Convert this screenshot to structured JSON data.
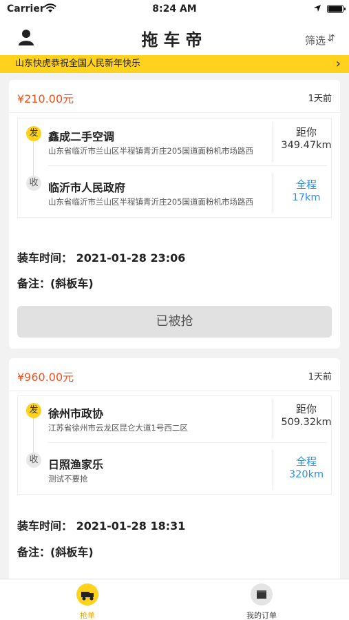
{
  "status_bar": {
    "carrier": "Carrier",
    "time": "8:24 AM"
  },
  "nav": {
    "title": "拖车帝",
    "filter_label": "筛选",
    "filter_icon": "⇵"
  },
  "notice": {
    "text": "山东快虎恭祝全国人民新年快乐",
    "chevron": "›"
  },
  "orders": [
    {
      "price": "¥210.00元",
      "age": "1天前",
      "from_badge": "发",
      "from_name": "鑫成二手空调",
      "from_addr": "山东省临沂市兰山区半程镇青沂庄205国道面粉机市场路西",
      "to_badge": "收",
      "to_name": "临沂市人民政府",
      "to_addr": "山东省临沂市兰山区半程镇青沂庄205国道面粉机市场路西",
      "dist_label": "距你",
      "dist_value": "349.47km",
      "total_label": "全程",
      "total_value": "17km",
      "load_time": "装车时间：  2021-01-28 23:06",
      "note": "备注：(斜板车)",
      "button": "已被抢"
    },
    {
      "price": "¥960.00元",
      "age": "1天前",
      "from_badge": "发",
      "from_name": "徐州市政协",
      "from_addr": "江苏省徐州市云龙区昆仑大道1号西二区",
      "to_badge": "收",
      "to_name": "日照渔家乐",
      "to_addr": "测试不要抢",
      "dist_label": "距你",
      "dist_value": "509.32km",
      "total_label": "全程",
      "total_value": "320km",
      "load_time": "装车时间：  2021-01-28 18:31",
      "note": "备注：(斜板车)"
    }
  ],
  "tabbar": {
    "tab1": "抢单",
    "tab2": "我的订单"
  },
  "colors": {
    "accent": "#ffd21e",
    "price": "#f0501e",
    "link": "#2a8ee6"
  }
}
